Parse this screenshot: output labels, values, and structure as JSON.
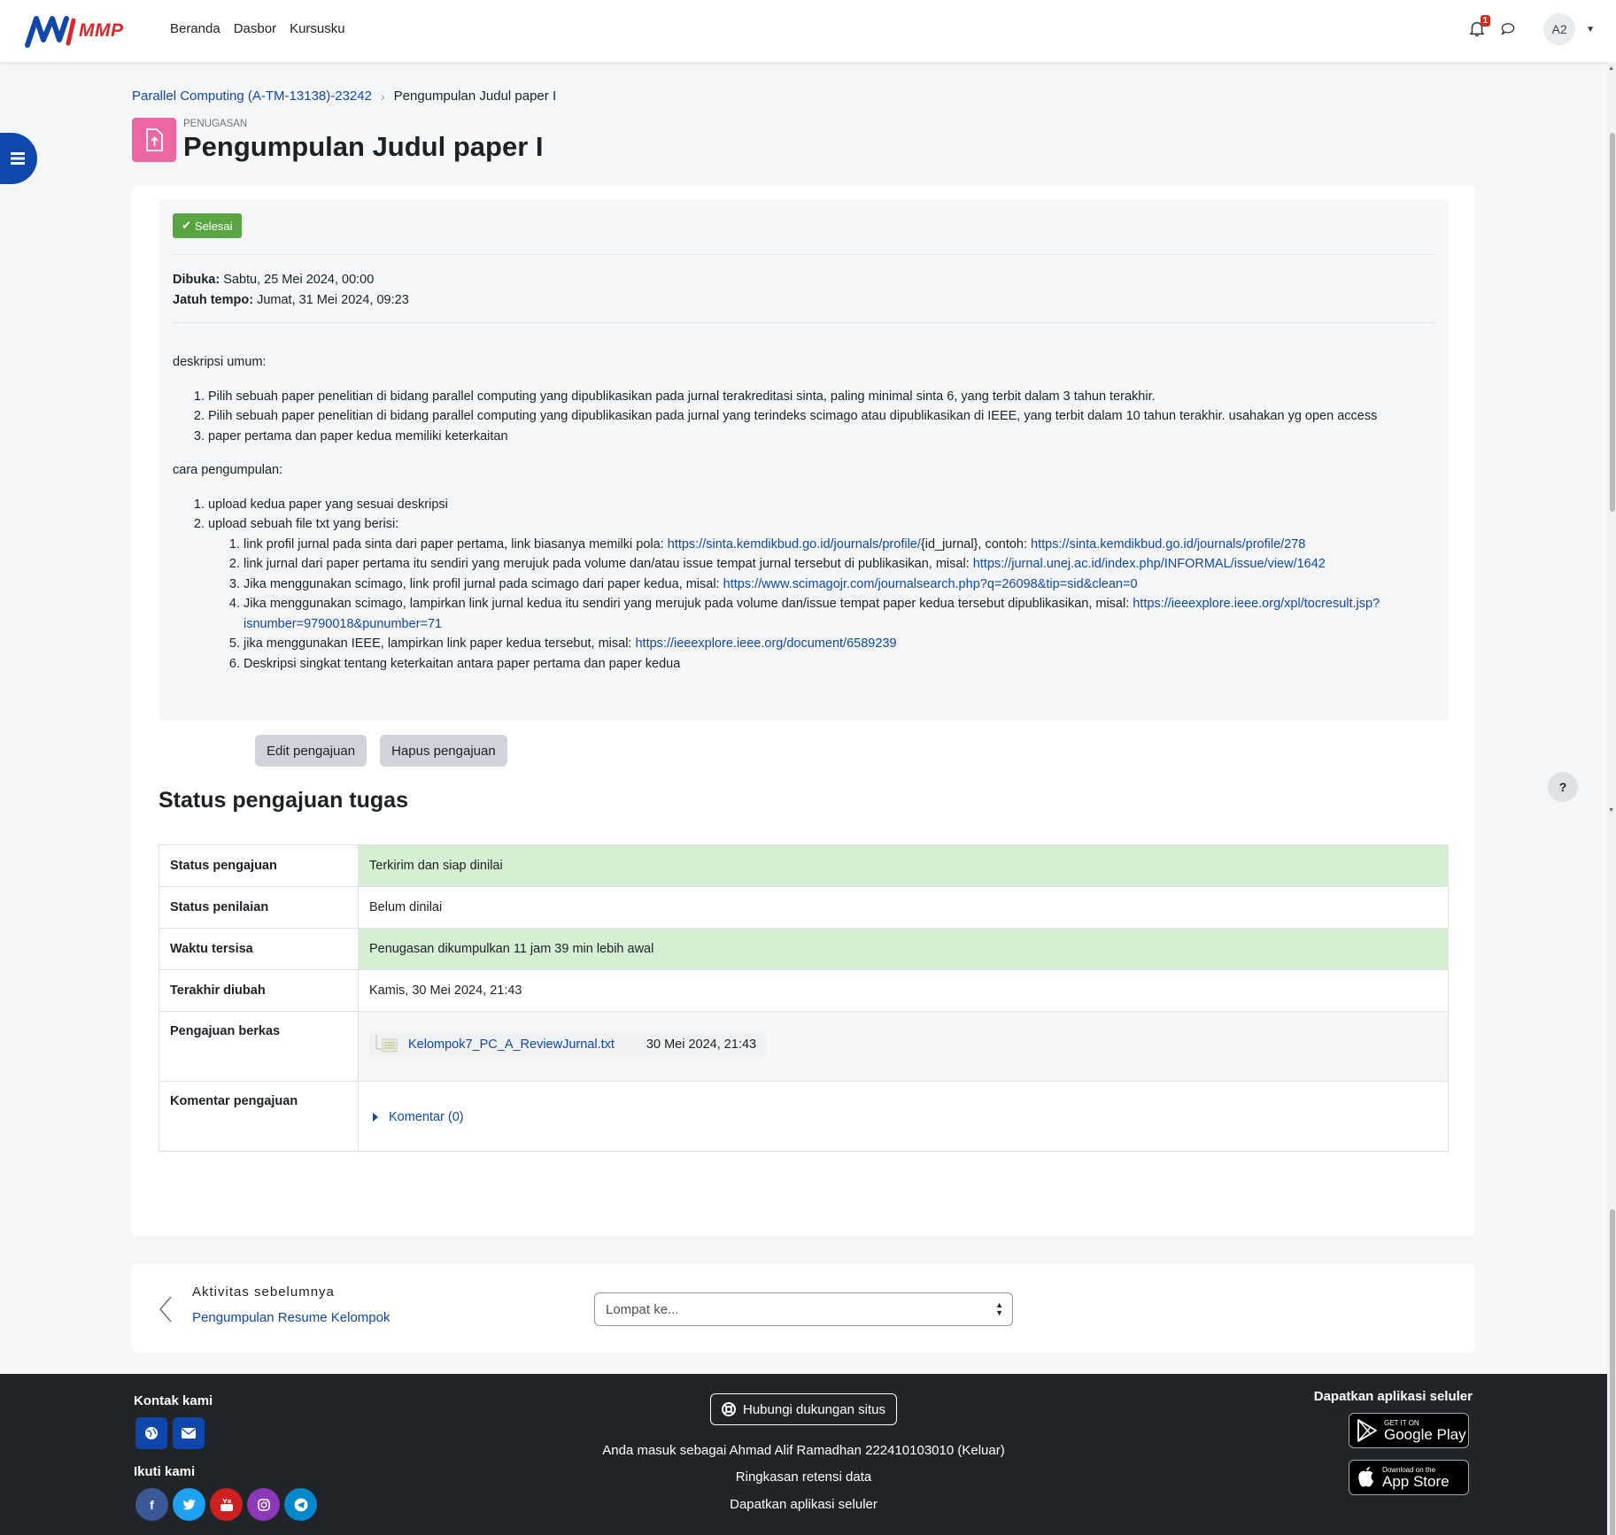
{
  "brand": {
    "logo_text": "MMP",
    "accent": "#0f47ad",
    "logo_red": "#d9272e"
  },
  "nav": {
    "links": [
      "Beranda",
      "Dasbor",
      "Kursusku"
    ],
    "notification_count": "1",
    "avatar_initials": "A2"
  },
  "breadcrumb": {
    "course": "Parallel Computing (A-TM-13138)-23242",
    "current": "Pengumpulan Judul paper I"
  },
  "header": {
    "kicker": "PENUGASAN",
    "title": "Pengumpulan Judul paper I"
  },
  "completion": {
    "label": "Selesai",
    "color": "#5aa543"
  },
  "dates": {
    "opened_label": "Dibuka:",
    "opened_value": "Sabtu, 25 Mei 2024, 00:00",
    "due_label": "Jatuh tempo:",
    "due_value": "Jumat, 31 Mei 2024, 09:23"
  },
  "description": {
    "general_heading": "deskripsi umum:",
    "general_items": [
      "Pilih sebuah paper penelitian di bidang parallel computing yang dipublikasikan pada jurnal terakreditasi sinta, paling minimal sinta 6, yang terbit dalam 3 tahun terakhir.",
      "Pilih sebuah paper penelitian di bidang parallel computing yang dipublikasikan pada jurnal yang terindeks scimago atau dipublikasikan di IEEE, yang terbit dalam 10 tahun terakhir. usahakan yg open access",
      "paper pertama dan paper kedua memiliki keterkaitan"
    ],
    "submit_heading": "cara pengumpulan:",
    "submit_item_1": "upload kedua paper yang sesuai deskripsi",
    "submit_item_2": "upload sebuah file txt yang berisi:",
    "sub1_text": "link profil jurnal pada sinta dari paper pertama, link biasanya memilki pola: ",
    "sub1_link1": "https://sinta.kemdikbud.go.id/journals/profile/",
    "sub1_mid": "{id_jurnal}, contoh: ",
    "sub1_link2": "https://sinta.kemdikbud.go.id/journals/profile/278",
    "sub2_text": "link jurnal dari paper pertama itu sendiri yang merujuk pada volume dan/atau issue tempat jurnal tersebut di publikasikan, misal: ",
    "sub2_link": "https://jurnal.unej.ac.id/index.php/INFORMAL/issue/view/1642",
    "sub3_text": "Jika menggunakan scimago, link profil jurnal pada scimago dari paper kedua, misal: ",
    "sub3_link": "https://www.scimagojr.com/journalsearch.php?q=26098&tip=sid&clean=0",
    "sub4_text": "Jika menggunakan scimago, lampirkan link jurnal kedua itu sendiri yang merujuk pada volume dan/issue tempat paper kedua tersebut dipublikasikan, misal: ",
    "sub4_link": "https://ieeexplore.ieee.org/xpl/tocresult.jsp?isnumber=9790018&punumber=71",
    "sub5_text": "jika menggunakan IEEE, lampirkan link paper kedua tersebut, misal: ",
    "sub5_link": "https://ieeexplore.ieee.org/document/6589239",
    "sub6_text": "Deskripsi singkat tentang keterkaitan antara paper pertama dan paper kedua"
  },
  "actions": {
    "edit": "Edit pengajuan",
    "delete": "Hapus pengajuan"
  },
  "status": {
    "title": "Status pengajuan tugas",
    "rows": [
      {
        "label": "Status pengajuan",
        "value": "Terkirim dan siap dinilai"
      },
      {
        "label": "Status penilaian",
        "value": "Belum dinilai"
      },
      {
        "label": "Waktu tersisa",
        "value": "Penugasan dikumpulkan 11 jam 39 min lebih awal"
      },
      {
        "label": "Terakhir diubah",
        "value": "Kamis, 30 Mei 2024, 21:43"
      },
      {
        "label": "Pengajuan berkas",
        "file_name": "Kelompok7_PC_A_ReviewJurnal.txt",
        "file_date": "30 Mei 2024, 21:43"
      },
      {
        "label": "Komentar pengajuan",
        "comments_link": "Komentar (0)"
      }
    ],
    "success_color": "#d4efd2"
  },
  "activity_nav": {
    "prev_label": "Aktivitas sebelumnya",
    "prev_link": "Pengumpulan Resume Kelompok",
    "jump_placeholder": "Lompat ke..."
  },
  "help": {
    "label": "?"
  },
  "footer": {
    "contact_heading": "Kontak kami",
    "follow_heading": "Ikuti kami",
    "support_button": "Hubungi dukungan situs",
    "logged_in": "Anda masuk sebagai Ahmad Alif Ramadhan 222410103010 (Keluar)",
    "data_retention": "Ringkasan retensi data",
    "get_app": "Dapatkan aplikasi seluler",
    "apps_heading": "Dapatkan aplikasi seluler",
    "google_play_small": "GET IT ON",
    "google_play_big": "Google Play",
    "app_store_small": "Download on the",
    "app_store_big": "App Store",
    "social_colors": [
      "#3b5998",
      "#1da1f2",
      "#cd201f",
      "#8a3ab9",
      "#0088cc"
    ]
  }
}
